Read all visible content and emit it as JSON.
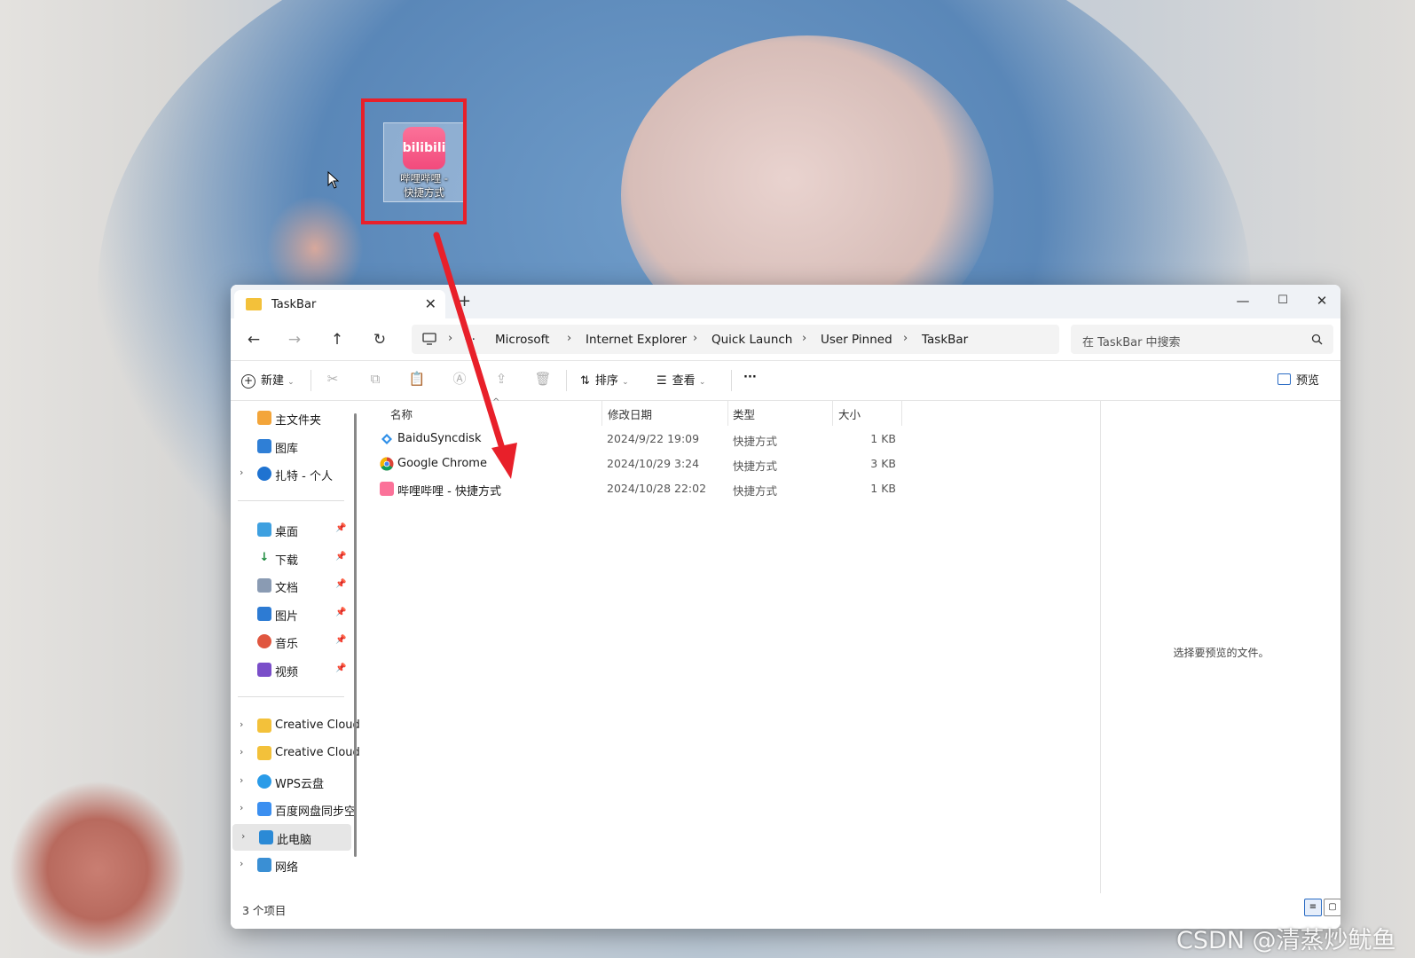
{
  "desktop": {
    "icon_label_line1": "哔哩哔哩 -",
    "icon_label_line2": "快捷方式",
    "icon_logo_text": "bilibili"
  },
  "colors": {
    "highlight": "#e8202a",
    "bilibili_pink": "#fb7299",
    "selected_bg": "#e6e6e6"
  },
  "window": {
    "tab_title": "TaskBar",
    "new_tab": "+",
    "close_tab": "✕",
    "minimize": "—",
    "maximize": "☐",
    "close": "✕"
  },
  "nav": {
    "back": "←",
    "forward": "→",
    "up": "↑",
    "refresh": "↻",
    "overflow": "···",
    "breadcrumbs": [
      "Microsoft",
      "Internet Explorer",
      "Quick Launch",
      "User Pinned",
      "TaskBar"
    ],
    "search_placeholder": "在 TaskBar 中搜索"
  },
  "toolbar": {
    "new_label": "新建",
    "sort_label": "排序",
    "view_label": "查看",
    "more": "···",
    "preview_label": "预览"
  },
  "sidebar": {
    "top": [
      {
        "label": "主文件夹",
        "icon": "home-icon"
      },
      {
        "label": "图库",
        "icon": "gallery-icon"
      },
      {
        "label": "扎特 - 个人",
        "icon": "onedrive-cloud-icon"
      }
    ],
    "quick": [
      {
        "label": "桌面",
        "icon": "desktop-icon"
      },
      {
        "label": "下载",
        "icon": "download-icon"
      },
      {
        "label": "文档",
        "icon": "document-icon"
      },
      {
        "label": "图片",
        "icon": "picture-icon"
      },
      {
        "label": "音乐",
        "icon": "music-icon"
      },
      {
        "label": "视频",
        "icon": "video-icon"
      }
    ],
    "drives": [
      {
        "label": "Creative Cloud",
        "icon": "creative-cloud-icon"
      },
      {
        "label": "Creative Cloud",
        "icon": "creative-cloud-icon"
      },
      {
        "label": "WPS云盘",
        "icon": "wps-cloud-icon"
      },
      {
        "label": "百度网盘同步空",
        "icon": "baidu-netdisk-icon"
      },
      {
        "label": "此电脑",
        "icon": "this-pc-icon"
      },
      {
        "label": "网络",
        "icon": "network-icon"
      }
    ]
  },
  "columns": [
    "名称",
    "修改日期",
    "类型",
    "大小"
  ],
  "files": [
    {
      "name": "BaiduSyncdisk",
      "date": "2024/9/22 19:09",
      "type": "快捷方式",
      "size": "1 KB",
      "icon": "baidu-sync-icon"
    },
    {
      "name": "Google Chrome",
      "date": "2024/10/29 3:24",
      "type": "快捷方式",
      "size": "3 KB",
      "icon": "chrome-icon"
    },
    {
      "name": "哔哩哔哩 - 快捷方式",
      "date": "2024/10/28 22:02",
      "type": "快捷方式",
      "size": "1 KB",
      "icon": "bilibili-icon"
    }
  ],
  "preview_message": "选择要预览的文件。",
  "status": "3 个项目",
  "watermark": "CSDN @清蒸炒鱿鱼"
}
